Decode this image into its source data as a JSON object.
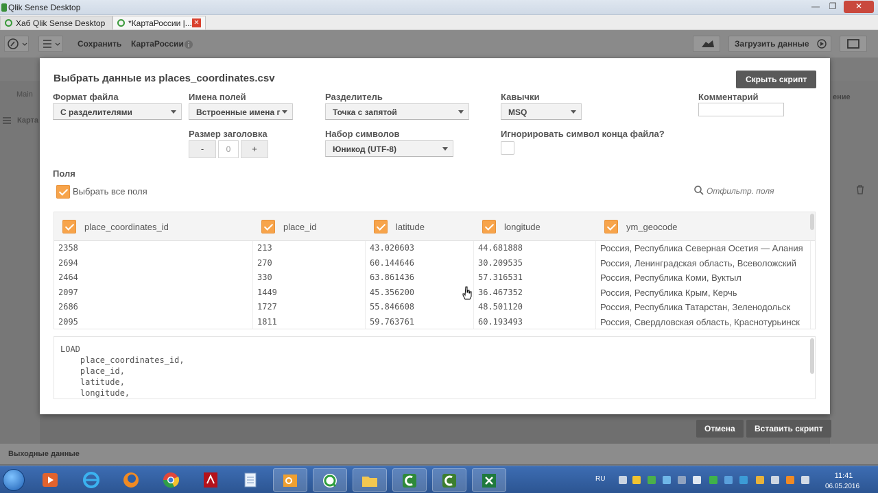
{
  "window": {
    "title": "Qlik Sense Desktop",
    "min": "—",
    "max": "❐",
    "close": "✕"
  },
  "tabs": [
    {
      "label": "Хаб Qlik Sense Desktop"
    },
    {
      "label": "*КартаРоссии |...",
      "close": "✕"
    }
  ],
  "toolbar": {
    "save": "Сохранить",
    "app_name": "КартаРоссии",
    "load_data": "Загрузить данные"
  },
  "sheetbar": {
    "main": "Main",
    "sheet": "Карта",
    "edit": "ение"
  },
  "bottombar": {
    "label": "Выходные данные"
  },
  "dialog": {
    "title": "Выбрать данные из places_coordinates.csv",
    "hide_script": "Скрыть скрипт",
    "file_format": {
      "label": "Формат файла",
      "value": "С разделителями"
    },
    "field_names": {
      "label": "Имена полей",
      "value": "Встроенные имена г"
    },
    "delimiter": {
      "label": "Разделитель",
      "value": "Точка с запятой"
    },
    "quotes": {
      "label": "Кавычки",
      "value": "MSQ"
    },
    "comment": {
      "label": "Комментарий",
      "value": ""
    },
    "header_size": {
      "label": "Размер заголовка",
      "minus": "-",
      "value": "0",
      "plus": "+"
    },
    "charset": {
      "label": "Набор символов",
      "value": "Юникод (UTF-8)"
    },
    "ignore_eof": {
      "label": "Игнорировать символ конца файла?",
      "checked": false
    },
    "fields_title": "Поля",
    "select_all": {
      "label": "Выбрать все поля",
      "checked": true
    },
    "filter_placeholder": "Отфильтр. поля",
    "columns": [
      {
        "name": "place_coordinates_id",
        "checked": true
      },
      {
        "name": "place_id",
        "checked": true
      },
      {
        "name": "latitude",
        "checked": true
      },
      {
        "name": "longitude",
        "checked": true
      },
      {
        "name": "ym_geocode",
        "checked": true
      }
    ],
    "rows": [
      [
        "2358",
        "213",
        "43.020603",
        "44.681888",
        "Россия, Республика Северная Осетия — Алания"
      ],
      [
        "2694",
        "270",
        "60.144646",
        "30.209535",
        "Россия, Ленинградская область, Всеволожский"
      ],
      [
        "2464",
        "330",
        "63.861436",
        "57.316531",
        "Россия, Республика Коми, Вуктыл"
      ],
      [
        "2097",
        "1449",
        "45.356200",
        "36.467352",
        "Россия, Республика Крым, Керчь"
      ],
      [
        "2686",
        "1727",
        "55.846608",
        "48.501120",
        "Россия, Республика Татарстан, Зеленодольск"
      ],
      [
        "2095",
        "1811",
        "59.763761",
        "60.193493",
        "Россия, Свердловская область, Краснотурьинск"
      ]
    ],
    "script_lines": [
      "LOAD",
      "    place_coordinates_id,",
      "    place_id,",
      "    latitude,",
      "    longitude,"
    ],
    "cancel": "Отмена",
    "insert_script": "Вставить скрипт"
  },
  "taskbar": {
    "lang": "RU",
    "time": "11:41",
    "date": "06.05.2016",
    "apps": [
      "windows-explorer",
      "media-player",
      "internet-explorer",
      "firefox",
      "chrome",
      "acrobat",
      "notepad",
      "outlook",
      "qlik-sense",
      "folder",
      "camtasia",
      "camtasia-2",
      "excel"
    ]
  },
  "colors": {
    "accent_checkbox": "#f7a44b",
    "dark_button": "#595959",
    "taskbar": "#2c5592"
  }
}
